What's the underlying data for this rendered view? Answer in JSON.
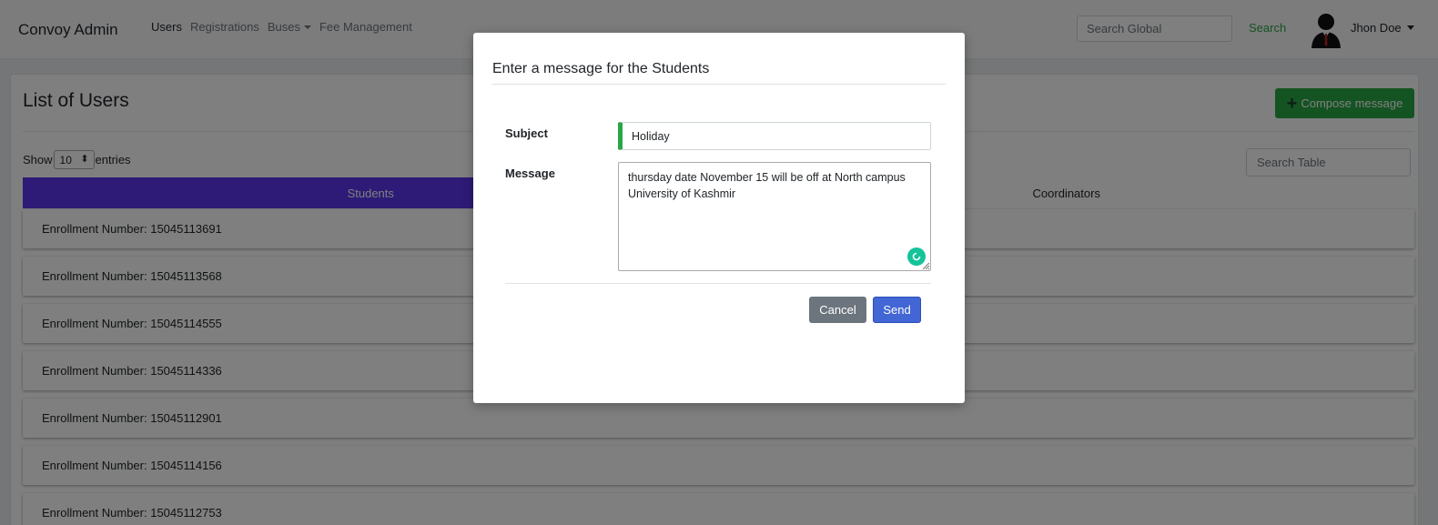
{
  "navbar": {
    "brand": "Convoy Admin",
    "links": [
      {
        "label": "Users",
        "active": true
      },
      {
        "label": "Registrations",
        "active": false
      },
      {
        "label": "Buses",
        "active": false,
        "dropdown": true
      },
      {
        "label": "Fee Management",
        "active": false
      }
    ],
    "search_placeholder": "Search Global",
    "search_button": "Search",
    "user_name": "Jhon Doe"
  },
  "page": {
    "title": "List of Users",
    "compose_button": "Compose message",
    "show_label": "Show",
    "entries_value": "10",
    "entries_label": "entries",
    "table_search_placeholder": "Search Table",
    "tabs": [
      {
        "label": "Students",
        "active": true
      },
      {
        "label": "Coordinators",
        "active": false
      }
    ],
    "rows": [
      "Enrollment Number: 15045113691",
      "Enrollment Number: 15045113568",
      "Enrollment Number: 15045114555",
      "Enrollment Number: 15045114336",
      "Enrollment Number: 15045112901",
      "Enrollment Number: 15045114156",
      "Enrollment Number: 15045112753"
    ]
  },
  "modal": {
    "title": "Enter a message for the Students",
    "subject_label": "Subject",
    "subject_value": "Holiday",
    "message_label": "Message",
    "message_value": "thursday date November 15 will be off at North campus University of Kashmir",
    "cancel_label": "Cancel",
    "send_label": "Send"
  },
  "colors": {
    "accent_tab": "#5a37ee",
    "success": "#28a745",
    "primary": "#4266d3",
    "secondary": "#6c757d"
  },
  "icons": [
    "user-avatar-icon",
    "plus-icon",
    "caret-down-icon",
    "grammar-check-icon",
    "resize-grip-icon"
  ]
}
